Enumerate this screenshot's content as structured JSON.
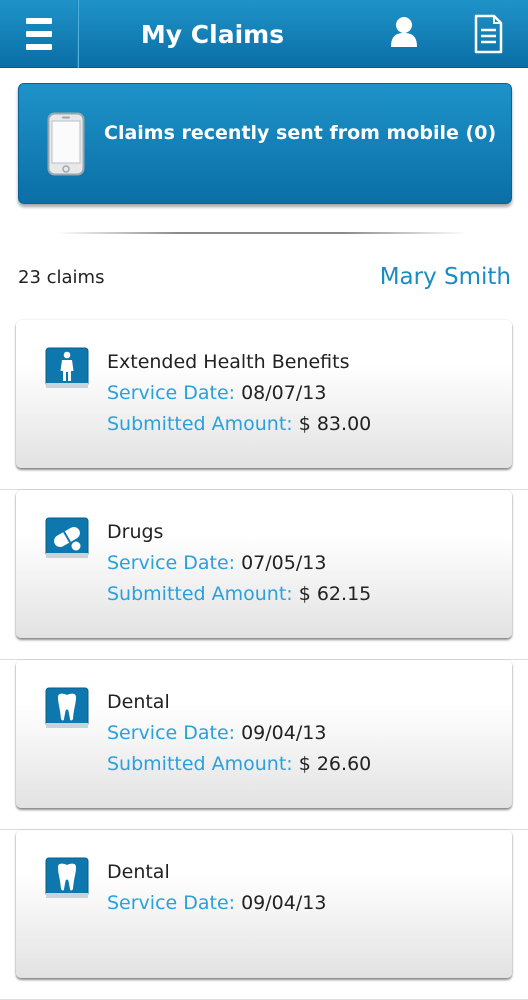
{
  "header": {
    "title": "My Claims",
    "menu_icon": "hamburger-menu-icon",
    "user_icon": "user-icon",
    "doc_icon": "document-icon"
  },
  "mobile_banner": {
    "text": "Claims recently sent from mobile (0)",
    "icon": "smartphone-icon"
  },
  "summary": {
    "claims_count": "23 claims",
    "member_name": "Mary Smith"
  },
  "labels": {
    "service_date": "Service Date:",
    "submitted_amount": "Submitted Amount:"
  },
  "claims": [
    {
      "type": "Extended Health Benefits",
      "icon": "person-body-icon",
      "service_date": "08/07/13",
      "amount": "$ 83.00"
    },
    {
      "type": "Drugs",
      "icon": "pill-icon",
      "service_date": "07/05/13",
      "amount": "$ 62.15"
    },
    {
      "type": "Dental",
      "icon": "tooth-icon",
      "service_date": "09/04/13",
      "amount": "$ 26.60"
    },
    {
      "type": "Dental",
      "icon": "tooth-icon",
      "service_date": "09/04/13",
      "amount": ""
    }
  ],
  "colors": {
    "header_blue": "#1585be",
    "accent_blue": "#29a1dc",
    "name_blue": "#1a8cc4",
    "text_dark": "#222222"
  }
}
